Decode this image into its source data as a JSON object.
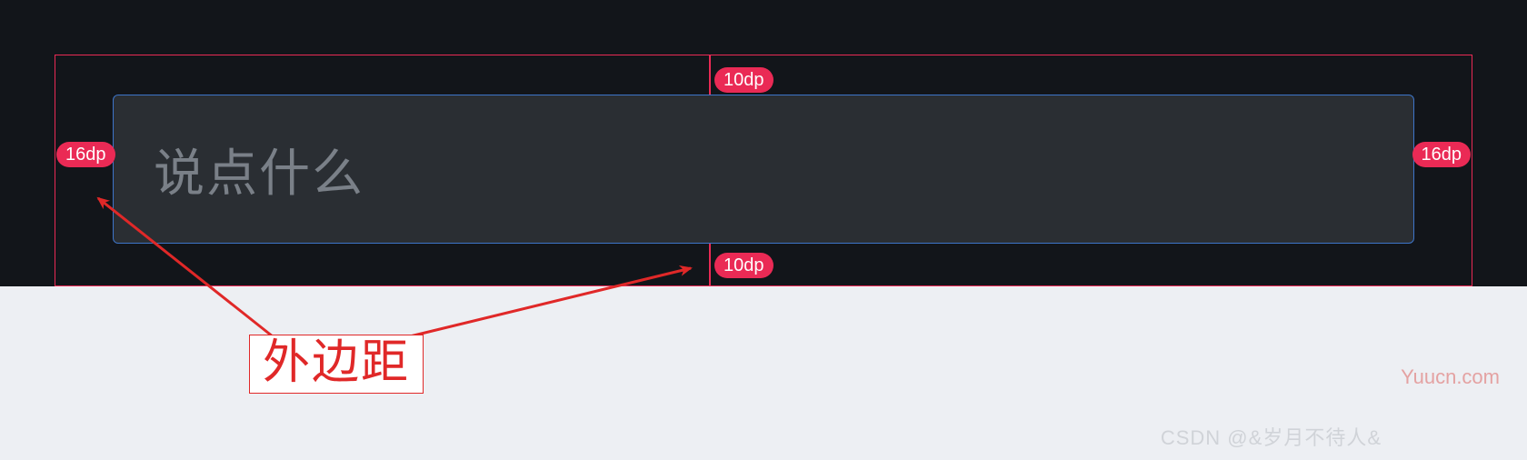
{
  "input": {
    "placeholder": "说点什么"
  },
  "margins": {
    "top": "10dp",
    "bottom": "10dp",
    "left": "16dp",
    "right": "16dp"
  },
  "annotation": {
    "label": "外边距"
  },
  "watermark": {
    "cn": "CSDN @&岁月不待人&",
    "en": "Yuucn.com"
  },
  "colors": {
    "accent": "#ea2a55",
    "selection": "#3d75c9",
    "dark_bg": "#12151a",
    "input_bg": "#2a2e33",
    "annotation": "#e02828"
  }
}
